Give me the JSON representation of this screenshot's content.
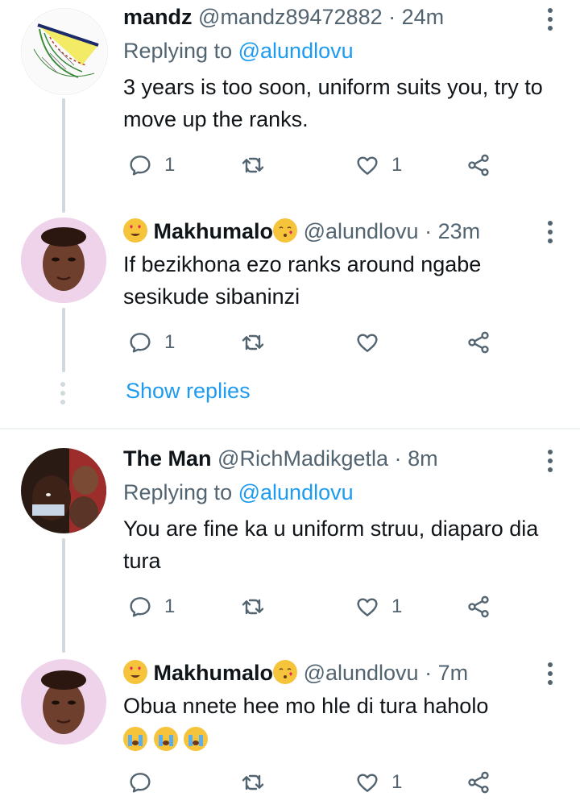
{
  "tweets": [
    {
      "name": "mandz",
      "handle": "@mandz89472882",
      "dot": "·",
      "time": "24m",
      "replying_prefix": "Replying to",
      "replying_to": "@alundlovu",
      "text": "3 years is too soon, uniform suits you, try to move up the ranks.",
      "reply_count": "1",
      "retweet_count": "",
      "like_count": "1"
    },
    {
      "name": "Makhumalo",
      "name_prefix_emoji": "heart-eyes-emoji",
      "name_suffix_emoji": "kissing-heart-emoji",
      "handle": "@alundlovu",
      "dot": "·",
      "time": "23m",
      "text": "If bezikhona ezo ranks around ngabe sesikude sibaninzi",
      "reply_count": "1",
      "retweet_count": "",
      "like_count": ""
    },
    {
      "name": "The Man",
      "handle": "@RichMadikgetla",
      "dot": "·",
      "time": "8m",
      "replying_prefix": "Replying to",
      "replying_to": "@alundlovu",
      "text": "You are fine ka u uniform struu, diaparo dia tura",
      "reply_count": "1",
      "retweet_count": "",
      "like_count": "1"
    },
    {
      "name": "Makhumalo",
      "name_prefix_emoji": "heart-eyes-emoji",
      "name_suffix_emoji": "kissing-heart-emoji",
      "handle": "@alundlovu",
      "dot": "·",
      "time": "7m",
      "text": "Obua nnete hee mo hle di tura haholo",
      "text_emojis": [
        "loudly-crying-emoji",
        "loudly-crying-emoji",
        "loudly-crying-emoji"
      ],
      "reply_count": "",
      "retweet_count": "",
      "like_count": "1"
    }
  ],
  "show_replies_label": "Show replies",
  "colors": {
    "link": "#1d9bf0",
    "secondary_text": "#536471",
    "primary_text": "#0f1419",
    "thread_line": "#cfd9de"
  },
  "icons": [
    "reply-icon",
    "retweet-icon",
    "like-icon",
    "share-icon",
    "more-icon"
  ]
}
